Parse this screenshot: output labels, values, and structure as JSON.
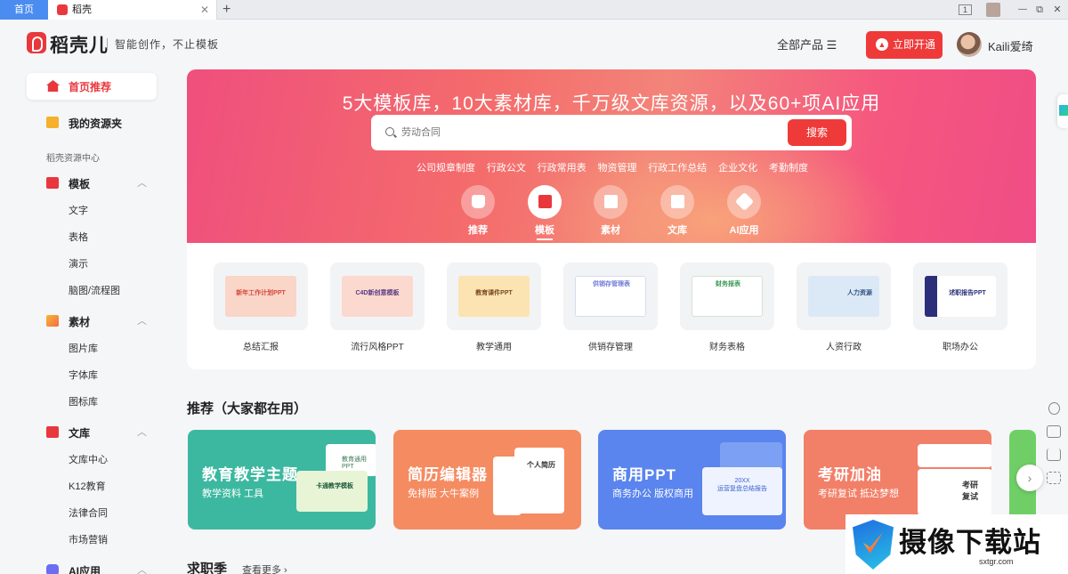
{
  "browser": {
    "home_tab": "首页",
    "app_tab": "稻壳",
    "close_glyph": "✕",
    "new_tab_glyph": "+",
    "controls": [
      "1",
      "",
      "⧉",
      "✕"
    ]
  },
  "header": {
    "brand": "稻壳儿",
    "slogan": "智能创作，不止模板",
    "all_products": "全部产品 ☰",
    "vip_button": "立即开通",
    "username": "Kaili爱绮"
  },
  "sidebar": {
    "home": "首页推荐",
    "my_folder": "我的资源夹",
    "caption": "稻壳资源中心",
    "groups": [
      {
        "label": "模板",
        "items": [
          "文字",
          "表格",
          "演示",
          "脑图/流程图"
        ]
      },
      {
        "label": "素材",
        "items": [
          "图片库",
          "字体库",
          "图标库"
        ]
      },
      {
        "label": "文库",
        "items": [
          "文库中心",
          "K12教育",
          "法律合同",
          "市场营销"
        ]
      },
      {
        "label": "AI应用",
        "items": []
      }
    ]
  },
  "banner": {
    "title": "5大模板库，10大素材库，千万级文库资源，以及60+项AI应用",
    "search_placeholder": "劳动合同",
    "search_button": "搜索",
    "hot_tags": [
      "公司规章制度",
      "行政公文",
      "行政常用表",
      "物资管理",
      "行政工作总结",
      "企业文化",
      "考勤制度"
    ],
    "categories": [
      {
        "label": "推荐",
        "active": false
      },
      {
        "label": "模板",
        "active": true
      },
      {
        "label": "素材",
        "active": false
      },
      {
        "label": "文库",
        "active": false
      },
      {
        "label": "AI应用",
        "active": false
      }
    ]
  },
  "templates": [
    {
      "label": "总结汇报",
      "thumb_text": "新年工作计划PPT",
      "color": "#f9d6c8",
      "text_color": "#d7473d"
    },
    {
      "label": "流行风格PPT",
      "thumb_text": "C4D新创意模板",
      "color": "#fbd9ce",
      "text_color": "#5a3b84"
    },
    {
      "label": "教学通用",
      "thumb_text": "教育课件PPT",
      "color": "#fbe3b2",
      "text_color": "#7b4a1d"
    },
    {
      "label": "供销存管理",
      "thumb_text": "供销存管理表",
      "color": "#ffffff",
      "text_color": "#6f7ad6"
    },
    {
      "label": "财务表格",
      "thumb_text": "财务报表",
      "color": "#ffffff",
      "text_color": "#3c9a55"
    },
    {
      "label": "人资行政",
      "thumb_text": "人力资源",
      "color": "#dbe9f7",
      "text_color": "#2e4f7f"
    },
    {
      "label": "职场办公",
      "thumb_text": "述职报告PPT",
      "color": "#ffffff",
      "text_color": "#2b2f7a"
    }
  ],
  "recommend": {
    "title": "推荐（大家都在用）",
    "cards": [
      {
        "title": "教育教学主题",
        "subtitle": "教学资料 工具",
        "color": "#3db8a0",
        "deco": [
          "教育通用PPT",
          "卡通教学模板"
        ]
      },
      {
        "title": "简历编辑器",
        "subtitle": "免排版 大牛案例",
        "color": "#f58b61",
        "deco": [
          "个人简历"
        ]
      },
      {
        "title": "商用PPT",
        "subtitle": "商务办公 版权商用",
        "color": "#5a84ee",
        "deco": [
          "20XX",
          "运营复盘总结报告"
        ]
      },
      {
        "title": "考研加油",
        "subtitle": "考研复试 抵达梦想",
        "color": "#f27f68",
        "deco": [
          "考研",
          "复试"
        ]
      }
    ],
    "next_glyph": "›"
  },
  "section2": {
    "title": "求职季",
    "see_more": "查看更多 ›"
  },
  "watermark": {
    "text": "摄像下载站",
    "url": "sxtgr.com"
  }
}
